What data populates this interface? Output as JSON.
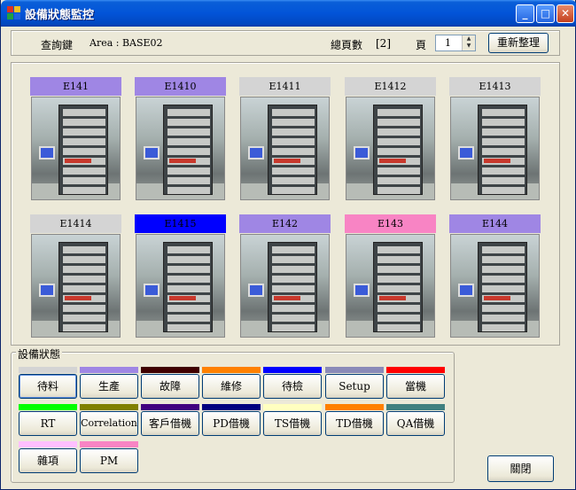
{
  "window": {
    "title": "設備狀態監控",
    "minimize_label": "_",
    "maximize_label": "□",
    "close_label": "✕"
  },
  "query": {
    "label": "查詢鍵",
    "area": "Area : BASE02",
    "total_pages_label": "總頁數",
    "total_pages_value": "[2]",
    "page_label": "頁",
    "page_value": "1",
    "refresh_button": "重新整理"
  },
  "equipment": [
    {
      "name": "E141",
      "color": "#9f86e4"
    },
    {
      "name": "E1410",
      "color": "#9f86e4"
    },
    {
      "name": "E1411",
      "color": "#d4d4d4"
    },
    {
      "name": "E1412",
      "color": "#d4d4d4"
    },
    {
      "name": "E1413",
      "color": "#d4d4d4"
    },
    {
      "name": "E1414",
      "color": "#d4d4d4"
    },
    {
      "name": "E1415",
      "color": "#0000ff"
    },
    {
      "name": "E142",
      "color": "#9f86e4"
    },
    {
      "name": "E143",
      "color": "#f884c4"
    },
    {
      "name": "E144",
      "color": "#9f86e4"
    }
  ],
  "legend": {
    "title": "設備狀態",
    "items": [
      {
        "label": "待料",
        "color": "#d4d4d4"
      },
      {
        "label": "生產",
        "color": "#9f86e4"
      },
      {
        "label": "故障",
        "color": "#400000"
      },
      {
        "label": "維修",
        "color": "#ff8000"
      },
      {
        "label": "待檢",
        "color": "#0000ff"
      },
      {
        "label": "Setup",
        "color": "#8a8ab8"
      },
      {
        "label": "當機",
        "color": "#ff0000"
      },
      {
        "label": "RT",
        "color": "#00ff00"
      },
      {
        "label": "Correlation",
        "color": "#808000"
      },
      {
        "label": "客戶借機",
        "color": "#400080"
      },
      {
        "label": "PD借機",
        "color": "#000080"
      },
      {
        "label": "TS借機",
        "color": "#ffffc0"
      },
      {
        "label": "TD借機",
        "color": "#ff8000"
      },
      {
        "label": "QA借機",
        "color": "#408080"
      },
      {
        "label": "雜項",
        "color": "#ffc0ff"
      },
      {
        "label": "PM",
        "color": "#f884c4"
      }
    ]
  },
  "close_button": "關閉"
}
